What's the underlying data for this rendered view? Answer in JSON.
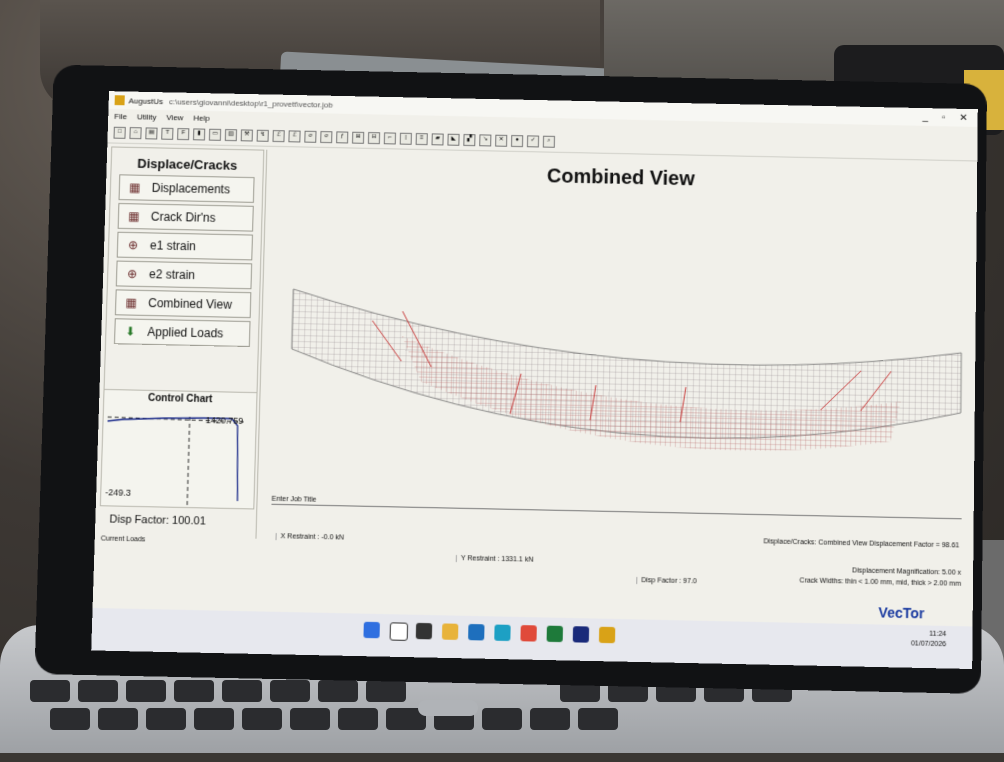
{
  "window": {
    "app_title": "AugustUs",
    "file_path": "c:\\users\\giovanni\\desktop\\r1_provett\\vector.job",
    "controls": [
      "_",
      "▫",
      "✕"
    ]
  },
  "menu": [
    "File",
    "Utility",
    "View",
    "Help"
  ],
  "toolbar_glyphs": [
    "□",
    "⌂",
    "▤",
    "T",
    "F",
    "▮",
    "▭",
    "▥",
    "⚒",
    "↯",
    "ℰ",
    "ℰ",
    "σ",
    "σ",
    "ƒ",
    "⊞",
    "⊟",
    "⌐",
    "|",
    "≡",
    "▰",
    "◣",
    "▞",
    "↘",
    "✕",
    "●",
    "✓",
    "⌕"
  ],
  "left_panel": {
    "title": "Displace/Cracks",
    "buttons": [
      {
        "label": "Displacements",
        "icon": "grid-icon"
      },
      {
        "label": "Crack Dir'ns",
        "icon": "grid-icon"
      },
      {
        "label": "e1 strain",
        "icon": "crosshair-icon"
      },
      {
        "label": "e2 strain",
        "icon": "crosshair-icon"
      },
      {
        "label": "Combined View",
        "icon": "grid-icon"
      },
      {
        "label": "Applied Loads",
        "icon": "arrow-down-icon"
      }
    ]
  },
  "control_chart": {
    "title": "Control Chart",
    "max_label": "1420.759",
    "min_label": "-249.3"
  },
  "disp_factor": {
    "label": "Disp Factor:",
    "value": "100.01"
  },
  "current_loads": "Current Loads",
  "view": {
    "title": "Combined View",
    "job_title": "Enter Job Title",
    "footer": "Displace/Cracks:  Combined View    Displacement Factor = 98.61",
    "magnification": "Displacement Magnification:  5.00 x",
    "crack_widths": "Crack Widths: thin < 1.00 mm, mid, thick > 2.00 mm",
    "mesh_color": "#b05a5a",
    "crack_color": "#c83c3c"
  },
  "status": {
    "x_restraint": "X Restraint : -0.0 kN",
    "y_restraint": "Y Restraint : 1331.1 kN",
    "disp_factor": "Disp Factor : 97.0"
  },
  "taskbar": {
    "logo": "VecTor",
    "time": "11:24",
    "date": "01/07/2026"
  }
}
